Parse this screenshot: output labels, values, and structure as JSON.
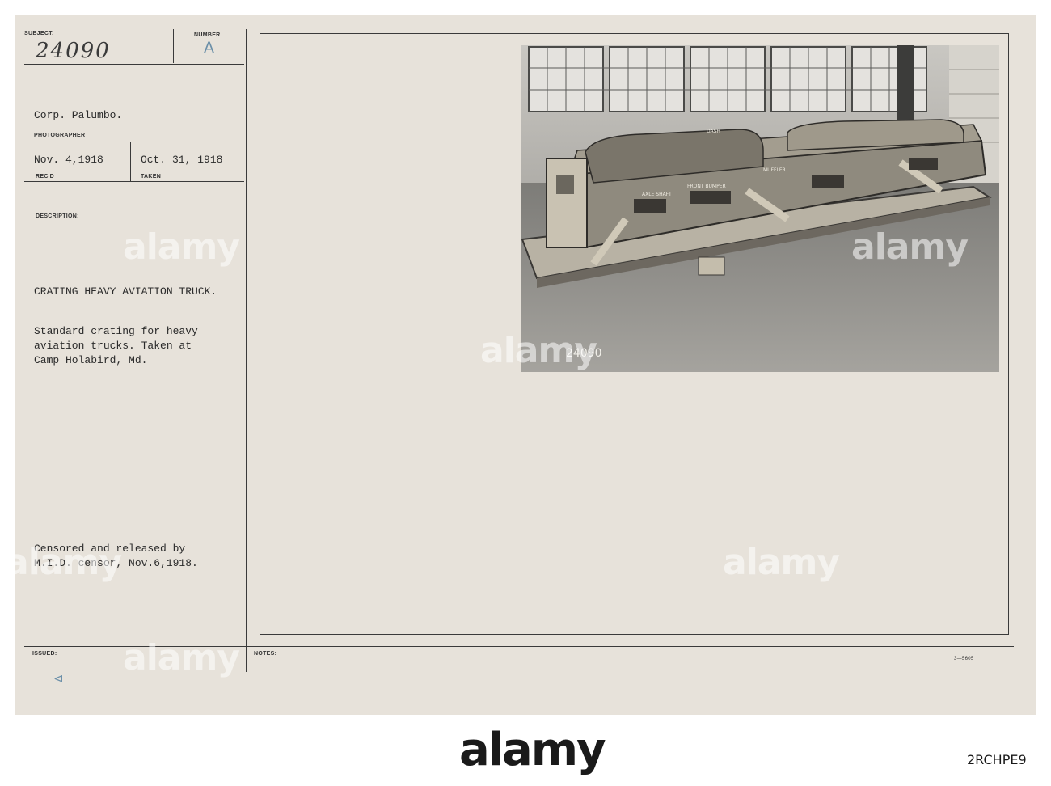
{
  "card": {
    "subject_label": "SUBJECT:",
    "subject_number": "24090",
    "number_label": "NUMBER",
    "number_value": "A",
    "photographer": "Corp. Palumbo.",
    "photographer_label": "PHOTOGRAPHER",
    "received_date": "Nov. 4,1918",
    "received_label": "REC'D",
    "taken_date": "Oct. 31, 1918",
    "taken_label": "TAKEN",
    "description_label": "DESCRIPTION:",
    "title": "CRATING HEAVY AVIATION TRUCK.",
    "description_lines": [
      "Standard crating for heavy",
      "aviation trucks. Taken at",
      "Camp Holabird, Md."
    ],
    "censor_lines": [
      "Censored and released by",
      "M.I.D. censor, Nov.6,1918."
    ],
    "issued_label": "ISSUED:",
    "issued_mark": "⊲",
    "notes_label": "NOTES:",
    "form_code": "3—5605"
  },
  "photo": {
    "negative_number": "24090",
    "crate_labels": [
      "AXLE SHAFT",
      "FRONT BUMPER",
      "MUFFLER",
      "DASH"
    ]
  },
  "watermark": {
    "logo": "alamy",
    "code": "2RCHPE9"
  }
}
